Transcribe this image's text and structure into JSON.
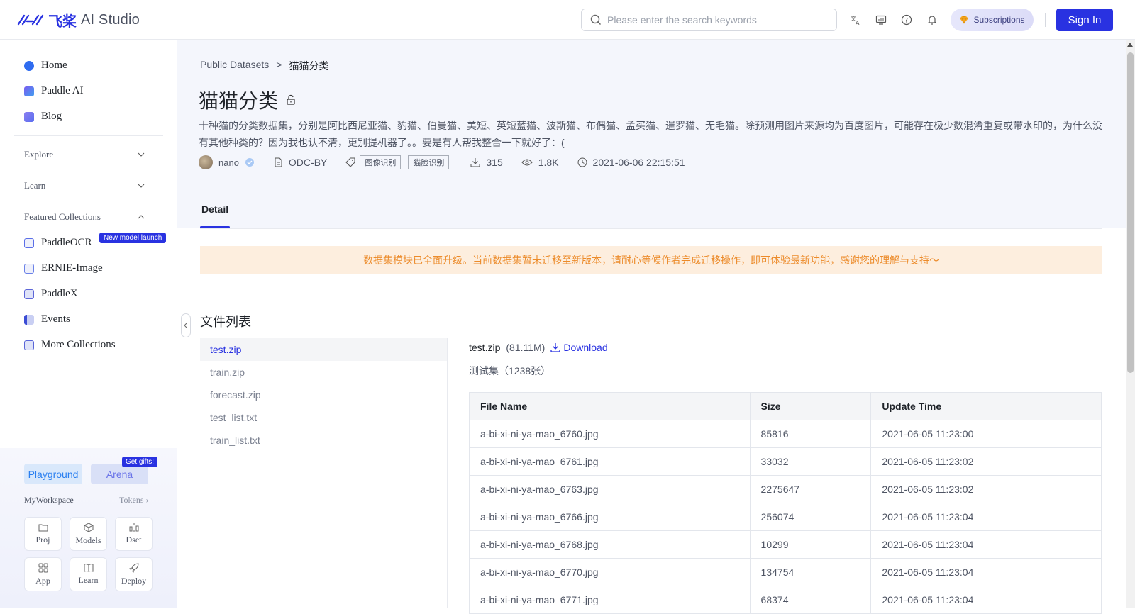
{
  "header": {
    "logo_cn": "飞桨",
    "logo_text": "AI Studio",
    "search_placeholder": "Please enter the search keywords",
    "subscriptions_label": "Subscriptions",
    "signin_label": "Sign In"
  },
  "sidebar": {
    "items": [
      {
        "label": "Home",
        "color": "#2f6cf0"
      },
      {
        "label": "Paddle AI",
        "color": "#7a5cf0"
      },
      {
        "label": "Blog",
        "color": "#6f7ff0"
      }
    ],
    "sections": [
      "Explore",
      "Learn",
      "Featured Collections"
    ],
    "collections": [
      {
        "label": "PaddleOCR",
        "color": "#5b6fe8"
      },
      {
        "label": "ERNIE-Image",
        "color": "#6b82e8"
      },
      {
        "label": "PaddleX",
        "color": "#5e67d8"
      },
      {
        "label": "Events",
        "color": "#3b4cd4"
      },
      {
        "label": "More Collections",
        "color": "#5a66d8"
      }
    ],
    "new_badge": "New model launch",
    "playground_label": "Playground",
    "arena_label": "Arena",
    "gifts_badge": "Get gifts!",
    "workspace_label": "MyWorkspace",
    "tokens_label": "Tokens",
    "tiles": [
      "Proj",
      "Models",
      "Dset",
      "App",
      "Learn",
      "Deploy"
    ]
  },
  "dataset": {
    "breadcrumb_parent": "Public Datasets",
    "breadcrumb_sep": ">",
    "breadcrumb_current": "猫猫分类",
    "title": "猫猫分类",
    "description": "十种猫的分类数据集，分别是阿比西尼亚猫、豹猫、伯曼猫、美短、英短蓝猫、波斯猫、布偶猫、孟买猫、暹罗猫、无毛猫。除预测用图片来源均为百度图片，可能存在极少数混淆重复或带水印的，为什么没有其他种类的？因为我也认不清，更别提机器了。。要是有人帮我整合一下就好了：(",
    "author": "nano",
    "license": "ODC-BY",
    "tags": [
      "图像识别",
      "猫脸识别"
    ],
    "downloads": "315",
    "views": "1.8K",
    "updated": "2021-06-06 22:15:51",
    "tab_detail": "Detail"
  },
  "notice": "数据集模块已全面升级。当前数据集暂未迁移至新版本，请耐心等候作者完成迁移操作，即可体验最新功能，感谢您的理解与支持～",
  "files": {
    "section_title": "文件列表",
    "list": [
      "test.zip",
      "train.zip",
      "forecast.zip",
      "test_list.txt",
      "train_list.txt"
    ],
    "selected_name": "test.zip",
    "selected_size": "(81.11M)",
    "download_label": "Download",
    "selected_desc": "测试集（1238张）",
    "columns": [
      "File Name",
      "Size",
      "Update Time"
    ],
    "rows": [
      [
        "a-bi-xi-ni-ya-mao_6760.jpg",
        "85816",
        "2021-06-05 11:23:00"
      ],
      [
        "a-bi-xi-ni-ya-mao_6761.jpg",
        "33032",
        "2021-06-05 11:23:02"
      ],
      [
        "a-bi-xi-ni-ya-mao_6763.jpg",
        "2275647",
        "2021-06-05 11:23:02"
      ],
      [
        "a-bi-xi-ni-ya-mao_6766.jpg",
        "256074",
        "2021-06-05 11:23:04"
      ],
      [
        "a-bi-xi-ni-ya-mao_6768.jpg",
        "10299",
        "2021-06-05 11:23:04"
      ],
      [
        "a-bi-xi-ni-ya-mao_6770.jpg",
        "134754",
        "2021-06-05 11:23:04"
      ],
      [
        "a-bi-xi-ni-ya-mao_6771.jpg",
        "68374",
        "2021-06-05 11:23:04"
      ]
    ]
  }
}
